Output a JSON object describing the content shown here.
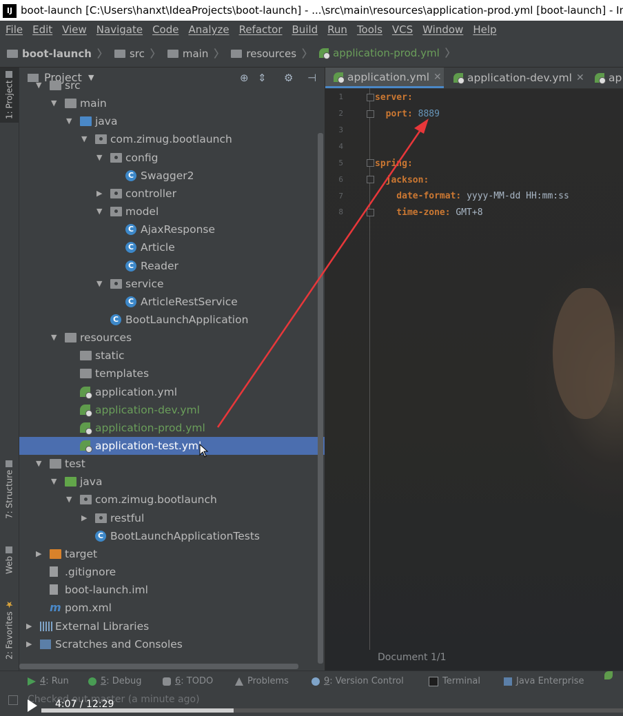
{
  "window": {
    "title": "boot-launch [C:\\Users\\hanxt\\IdeaProjects\\boot-launch] - ...\\src\\main\\resources\\application-prod.yml [boot-launch] - IntelliJ IDEA"
  },
  "menu": [
    "File",
    "Edit",
    "View",
    "Navigate",
    "Code",
    "Analyze",
    "Refactor",
    "Build",
    "Run",
    "Tools",
    "VCS",
    "Window",
    "Help"
  ],
  "breadcrumb": [
    "boot-launch",
    "src",
    "main",
    "resources",
    "application-prod.yml"
  ],
  "side_tabs": {
    "project": "1: Project",
    "structure": "7: Structure",
    "web": "Web",
    "favorites": "2: Favorites"
  },
  "project_panel": {
    "title": "Project",
    "tree": [
      {
        "label": "src",
        "arrow": "▼",
        "icon": "folder"
      },
      {
        "label": "main",
        "arrow": "▼",
        "icon": "folder"
      },
      {
        "label": "java",
        "arrow": "▼",
        "icon": "folder-blue"
      },
      {
        "label": "com.zimug.bootlaunch",
        "arrow": "▼",
        "icon": "package"
      },
      {
        "label": "config",
        "arrow": "▼",
        "icon": "package"
      },
      {
        "label": "Swagger2",
        "arrow": "",
        "icon": "class"
      },
      {
        "label": "controller",
        "arrow": "▶",
        "icon": "package"
      },
      {
        "label": "model",
        "arrow": "▼",
        "icon": "package"
      },
      {
        "label": "AjaxResponse",
        "arrow": "",
        "icon": "class"
      },
      {
        "label": "Article",
        "arrow": "",
        "icon": "class"
      },
      {
        "label": "Reader",
        "arrow": "",
        "icon": "class"
      },
      {
        "label": "service",
        "arrow": "▼",
        "icon": "package"
      },
      {
        "label": "ArticleRestService",
        "arrow": "",
        "icon": "class"
      },
      {
        "label": "BootLaunchApplication",
        "arrow": "",
        "icon": "class-spring"
      },
      {
        "label": "resources",
        "arrow": "▼",
        "icon": "folder-res"
      },
      {
        "label": "static",
        "arrow": "",
        "icon": "folder"
      },
      {
        "label": "templates",
        "arrow": "",
        "icon": "folder"
      },
      {
        "label": "application.yml",
        "arrow": "",
        "icon": "yml"
      },
      {
        "label": "application-dev.yml",
        "arrow": "",
        "icon": "yml",
        "green": true
      },
      {
        "label": "application-prod.yml",
        "arrow": "",
        "icon": "yml",
        "green": true
      },
      {
        "label": "application-test.yml",
        "arrow": "",
        "icon": "yml",
        "selected": true
      },
      {
        "label": "test",
        "arrow": "▼",
        "icon": "folder"
      },
      {
        "label": "java",
        "arrow": "▼",
        "icon": "folder-green"
      },
      {
        "label": "com.zimug.bootlaunch",
        "arrow": "▼",
        "icon": "package"
      },
      {
        "label": "restful",
        "arrow": "▶",
        "icon": "package"
      },
      {
        "label": "BootLaunchApplicationTests",
        "arrow": "",
        "icon": "class-spring"
      },
      {
        "label": "target",
        "arrow": "▶",
        "icon": "folder-orange"
      },
      {
        "label": ".gitignore",
        "arrow": "",
        "icon": "file"
      },
      {
        "label": "boot-launch.iml",
        "arrow": "",
        "icon": "iml"
      },
      {
        "label": "pom.xml",
        "arrow": "",
        "icon": "maven"
      },
      {
        "label": "External Libraries",
        "arrow": "▶",
        "icon": "libs"
      },
      {
        "label": "Scratches and Consoles",
        "arrow": "▶",
        "icon": "scratch"
      }
    ]
  },
  "editor": {
    "tabs": [
      {
        "label": "application.yml",
        "active": true
      },
      {
        "label": "application-dev.yml",
        "active": false
      },
      {
        "label": "ap",
        "active": false
      }
    ],
    "lines": [
      {
        "n": "1",
        "key": "server:",
        "val": ""
      },
      {
        "n": "2",
        "key": "  port: ",
        "val": "8889"
      },
      {
        "n": "3",
        "key": "",
        "val": ""
      },
      {
        "n": "4",
        "key": "",
        "val": ""
      },
      {
        "n": "5",
        "key": "spring:",
        "val": ""
      },
      {
        "n": "6",
        "key": "  jackson:",
        "val": ""
      },
      {
        "n": "7",
        "key": "    date-format: ",
        "val": "yyyy-MM-dd HH:mm:ss"
      },
      {
        "n": "8",
        "key": "    time-zone: ",
        "val": "GMT+8"
      }
    ],
    "status": "Document 1/1"
  },
  "bottom_tools": [
    {
      "num": "4",
      "label": ": Run"
    },
    {
      "num": "5",
      "label": ": Debug"
    },
    {
      "num": "6",
      "label": ": TODO"
    },
    {
      "num": "",
      "label": "Problems"
    },
    {
      "num": "9",
      "label": ": Version Control"
    },
    {
      "num": "",
      "label": "Terminal"
    },
    {
      "num": "",
      "label": "Java Enterprise"
    }
  ],
  "status_text": "Checked out master (a minute ago)",
  "video": {
    "time": "4:07 / 12:29",
    "progress": 0.33
  },
  "colors": {
    "bg": "#2b2b2b",
    "panel": "#3c3f41",
    "selection": "#4b6eaf",
    "keyword": "#cc7832",
    "number": "#6897bb",
    "green_file": "#6a9e5a",
    "annotation_arrow": "#e8373a"
  }
}
